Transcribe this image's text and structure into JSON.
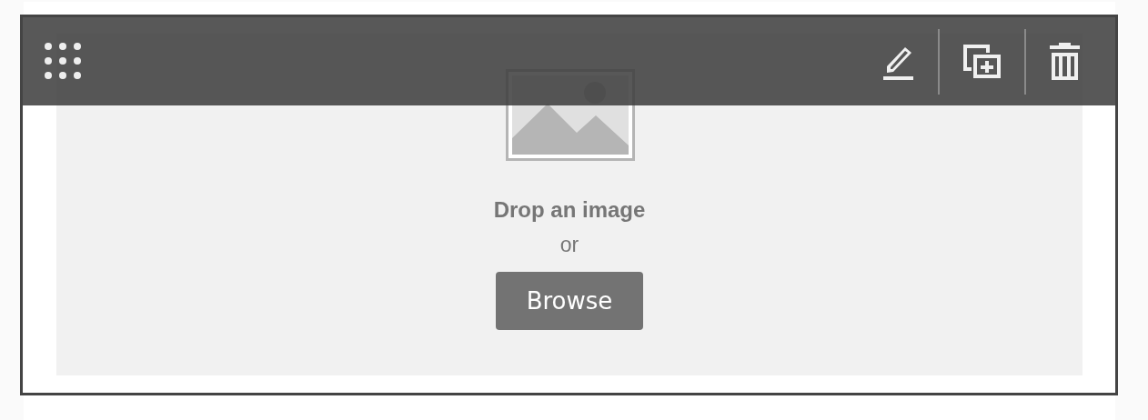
{
  "toolbar": {
    "actions": [
      {
        "kind": "edit"
      },
      {
        "kind": "duplicate"
      },
      {
        "kind": "delete"
      }
    ]
  },
  "dropzone": {
    "title": "Drop an image",
    "separator": "or",
    "button": "Browse"
  }
}
